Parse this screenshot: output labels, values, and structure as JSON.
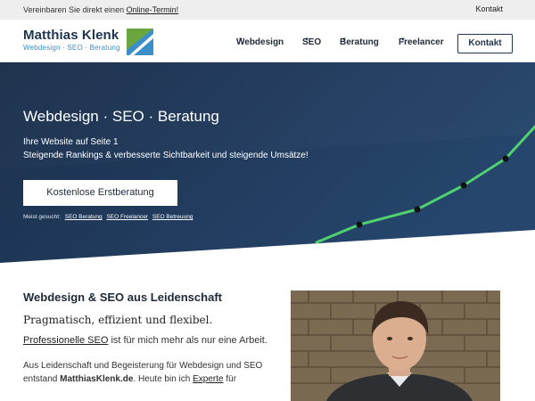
{
  "topbar": {
    "text": "Vereinbaren Sie direkt einen",
    "link": "Online-Termin!",
    "contact": "Kontakt"
  },
  "header": {
    "logo_name": "Matthias Klenk",
    "logo_tagline": "Webdesign · SEO · Beratung",
    "nav": [
      "Webdesign",
      "SEO",
      "Beratung",
      "Freelancer"
    ],
    "contact_button": "Kontakt"
  },
  "hero": {
    "title": "Webdesign · SEO · Beratung",
    "line1": "Ihre Website auf Seite 1",
    "line2": "Steigende Rankings & verbesserte Sichtbarkeit und steigende Umsätze!",
    "cta": "Kostenlose Erstberatung",
    "searched_label": "Meist gesucht:",
    "searched_links": [
      "SEO Beratung",
      "SEO Freelancer",
      "SEO Betreuung"
    ]
  },
  "content": {
    "heading": "Webdesign & SEO aus Leidenschaft",
    "tagline": "Pragmatisch, effizient und flexibel.",
    "p1_link": "Professionelle SEO",
    "p1_rest": " ist für mich mehr als nur eine Arbeit.",
    "p2_start": "Aus Leidenschaft und Begeisterung für Webdesign und SEO entstand ",
    "p2_bold": "MatthiasKlenk.de",
    "p2_mid": ". Heute bin ich ",
    "p2_link": "Experte",
    "p2_end": " für"
  },
  "colors": {
    "hero_dark": "#1b2f4b",
    "hero_mid": "#26466d",
    "accent_green": "#4fd170",
    "logo_blue": "#3b8fc9",
    "brand_navy": "#1e3550"
  }
}
